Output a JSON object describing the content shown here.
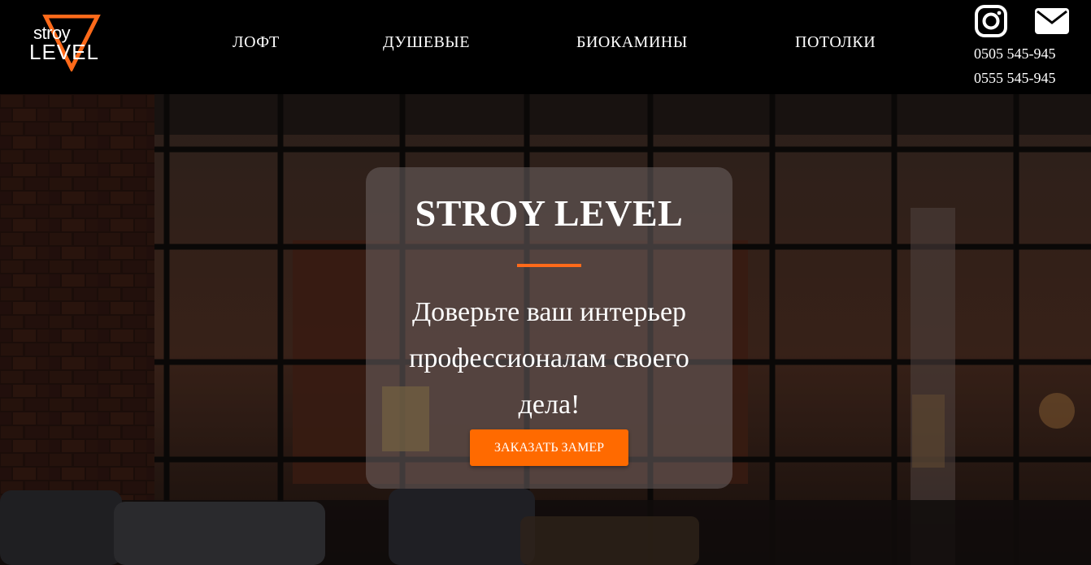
{
  "logo": {
    "top_text": "stroy",
    "bottom_text": "LEVEL",
    "accent_color": "#ff6a1a"
  },
  "nav": {
    "items": [
      {
        "label": "ЛОФТ"
      },
      {
        "label": "ДУШЕВЫЕ"
      },
      {
        "label": "БИОКАМИНЫ"
      },
      {
        "label": "ПОТОЛКИ"
      }
    ]
  },
  "contacts": {
    "instagram_icon": "instagram-icon",
    "mail_icon": "mail-icon",
    "phones": [
      "0505 545-945",
      "0555 545-945"
    ]
  },
  "hero": {
    "title": "STROY LEVEL",
    "text": "Доверьте ваш интерьер профессионалам своего дела!",
    "button_label": "ЗАКАЗАТЬ ЗАМЕР",
    "accent_color": "#ff6a00",
    "background_description_icon": "loft-interior-image"
  }
}
